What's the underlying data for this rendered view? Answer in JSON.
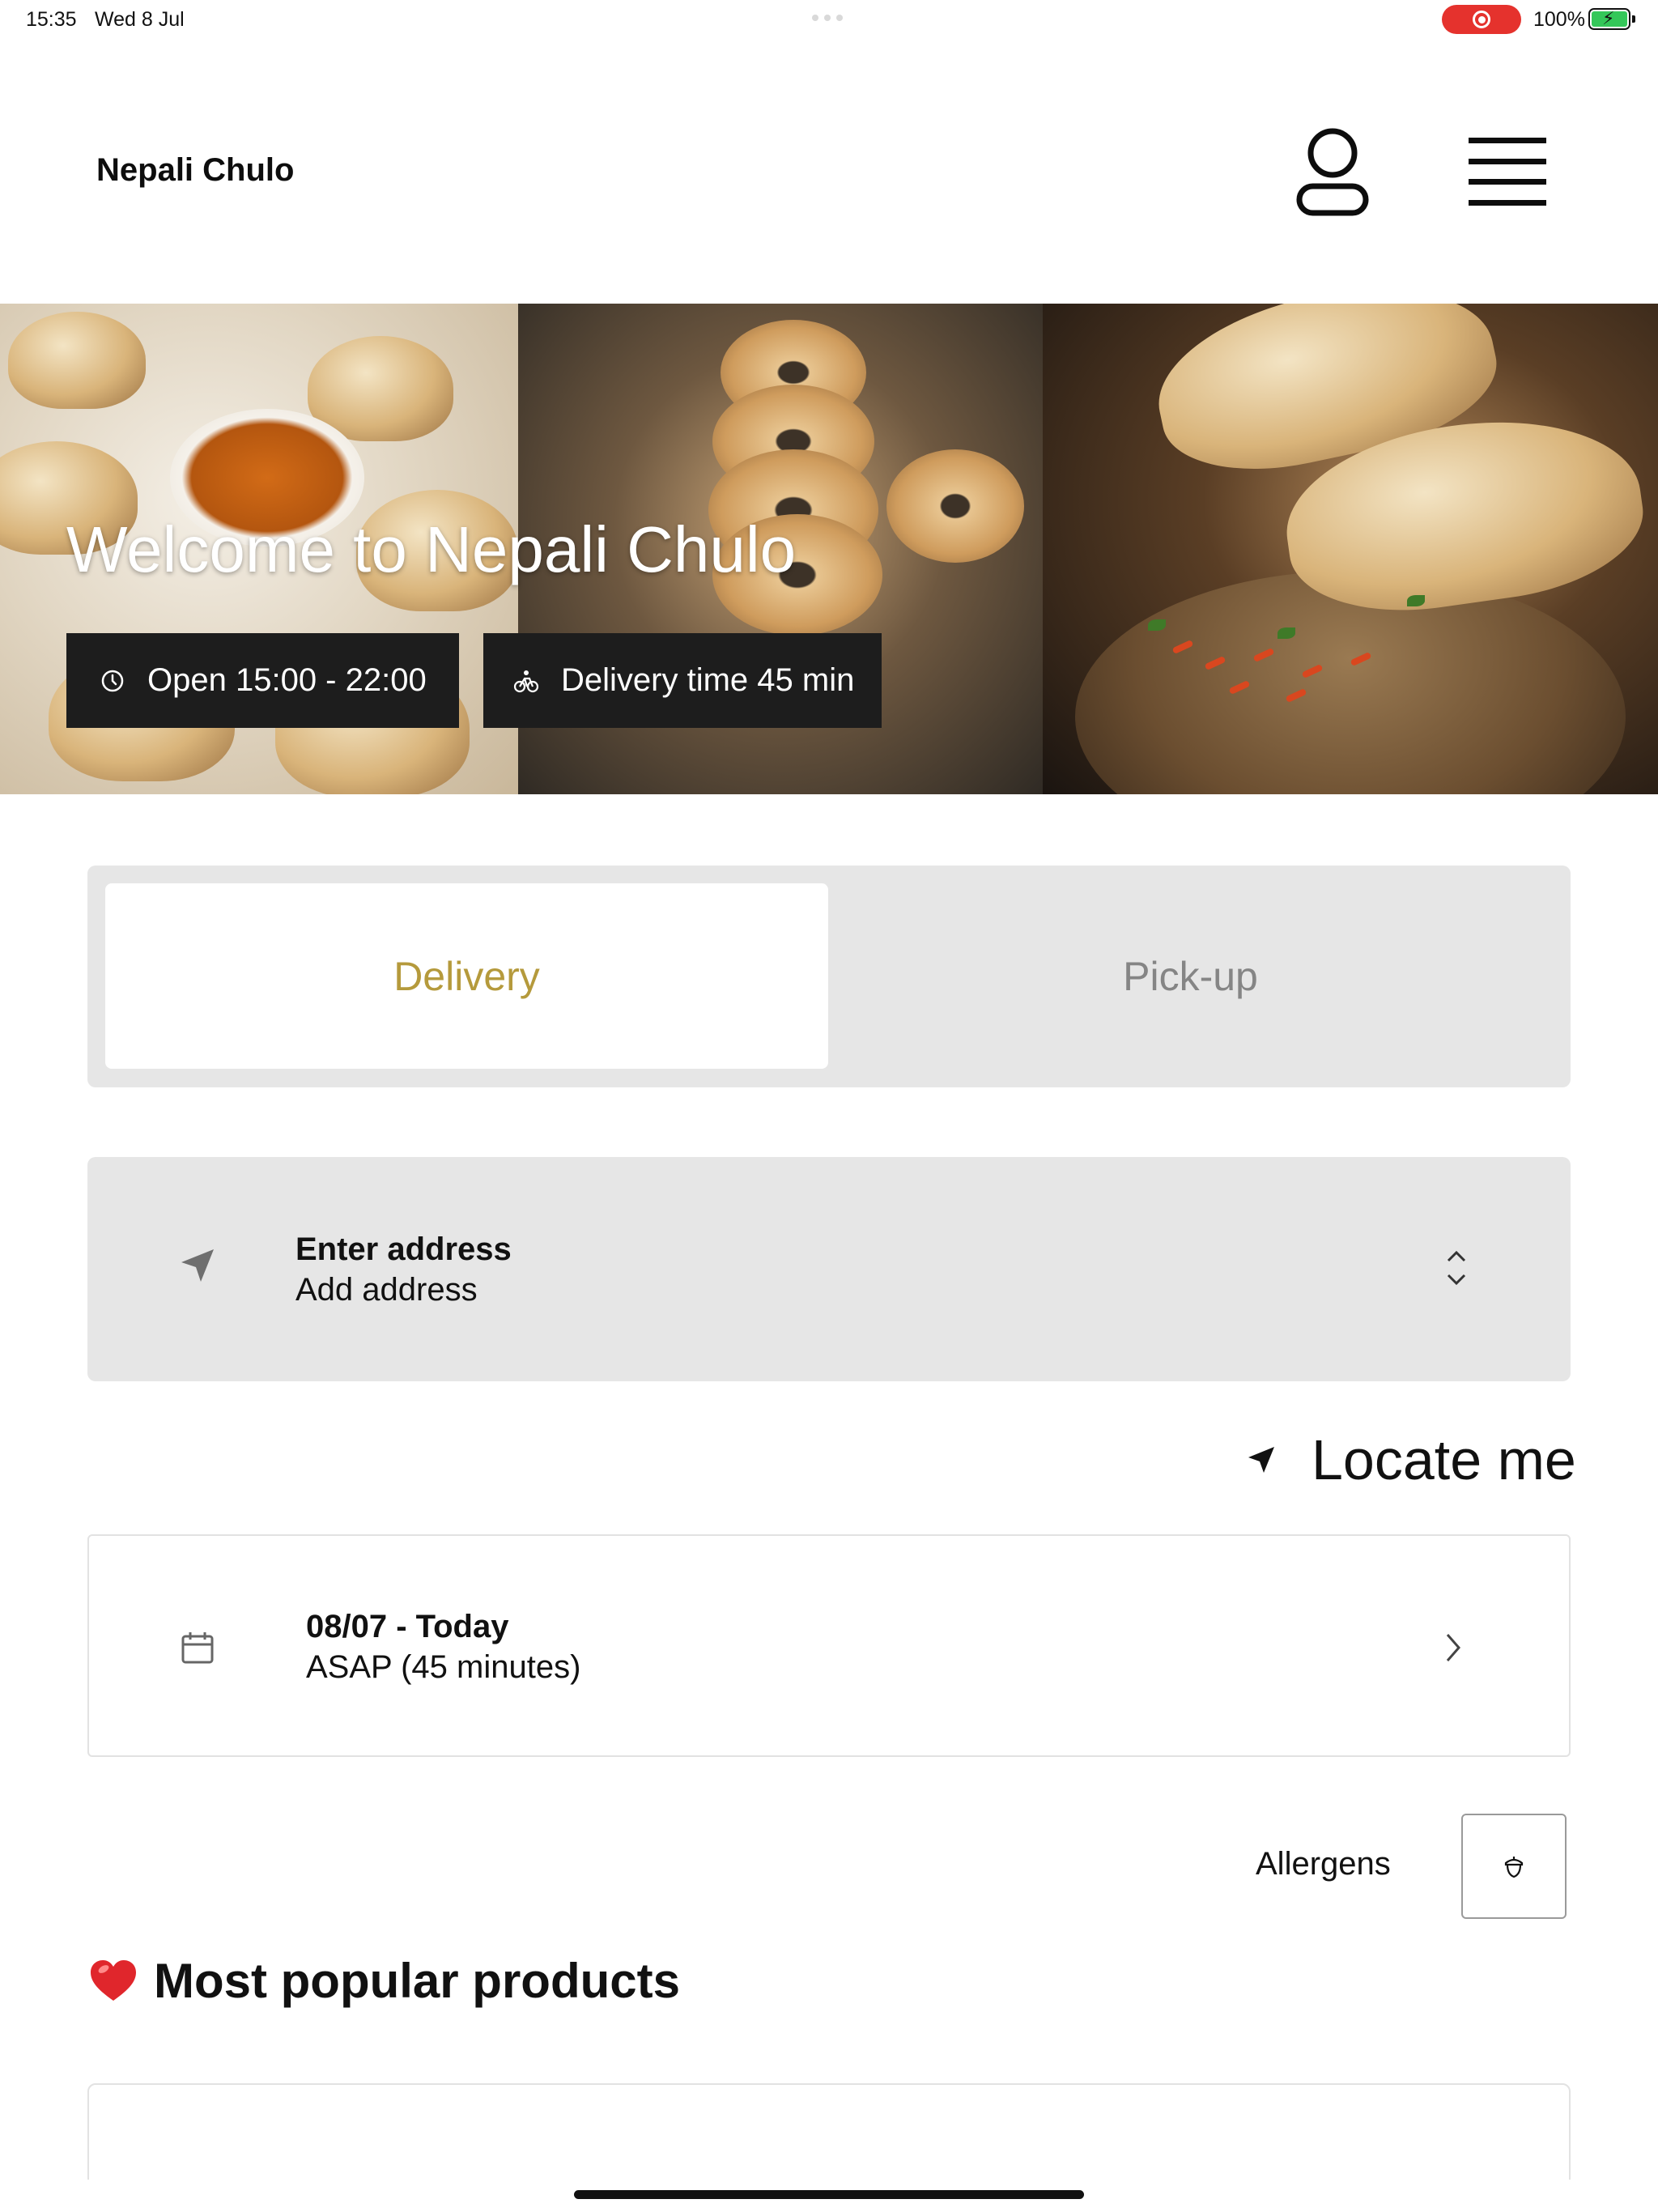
{
  "status_bar": {
    "time": "15:35",
    "date": "Wed 8 Jul",
    "battery": "100%"
  },
  "header": {
    "brand": "Nepali Chulo",
    "profile_icon": "person-icon",
    "menu_icon": "hamburger-icon"
  },
  "hero": {
    "title": "Welcome to Nepali Chulo",
    "open_hours": "Open 15:00 - 22:00",
    "delivery_time": "Delivery time 45 min",
    "open_icon": "clock-icon",
    "delivery_icon": "bike-icon"
  },
  "mode_toggle": {
    "delivery": "Delivery",
    "pickup": "Pick-up",
    "selected": "Delivery",
    "accent_color": "#b59a3c"
  },
  "address": {
    "title": "Enter address",
    "subtitle": "Add address",
    "icon": "navigation-arrow-icon"
  },
  "locate_me": {
    "label": "Locate me",
    "icon": "location-arrow-icon"
  },
  "schedule": {
    "date": "08/07 - Today",
    "time": "ASAP (45 minutes)",
    "icon": "calendar-icon"
  },
  "allergens": {
    "label": "Allergens",
    "icon": "acorn-icon"
  },
  "popular": {
    "heading": "Most popular products",
    "icon": "heart-icon"
  }
}
